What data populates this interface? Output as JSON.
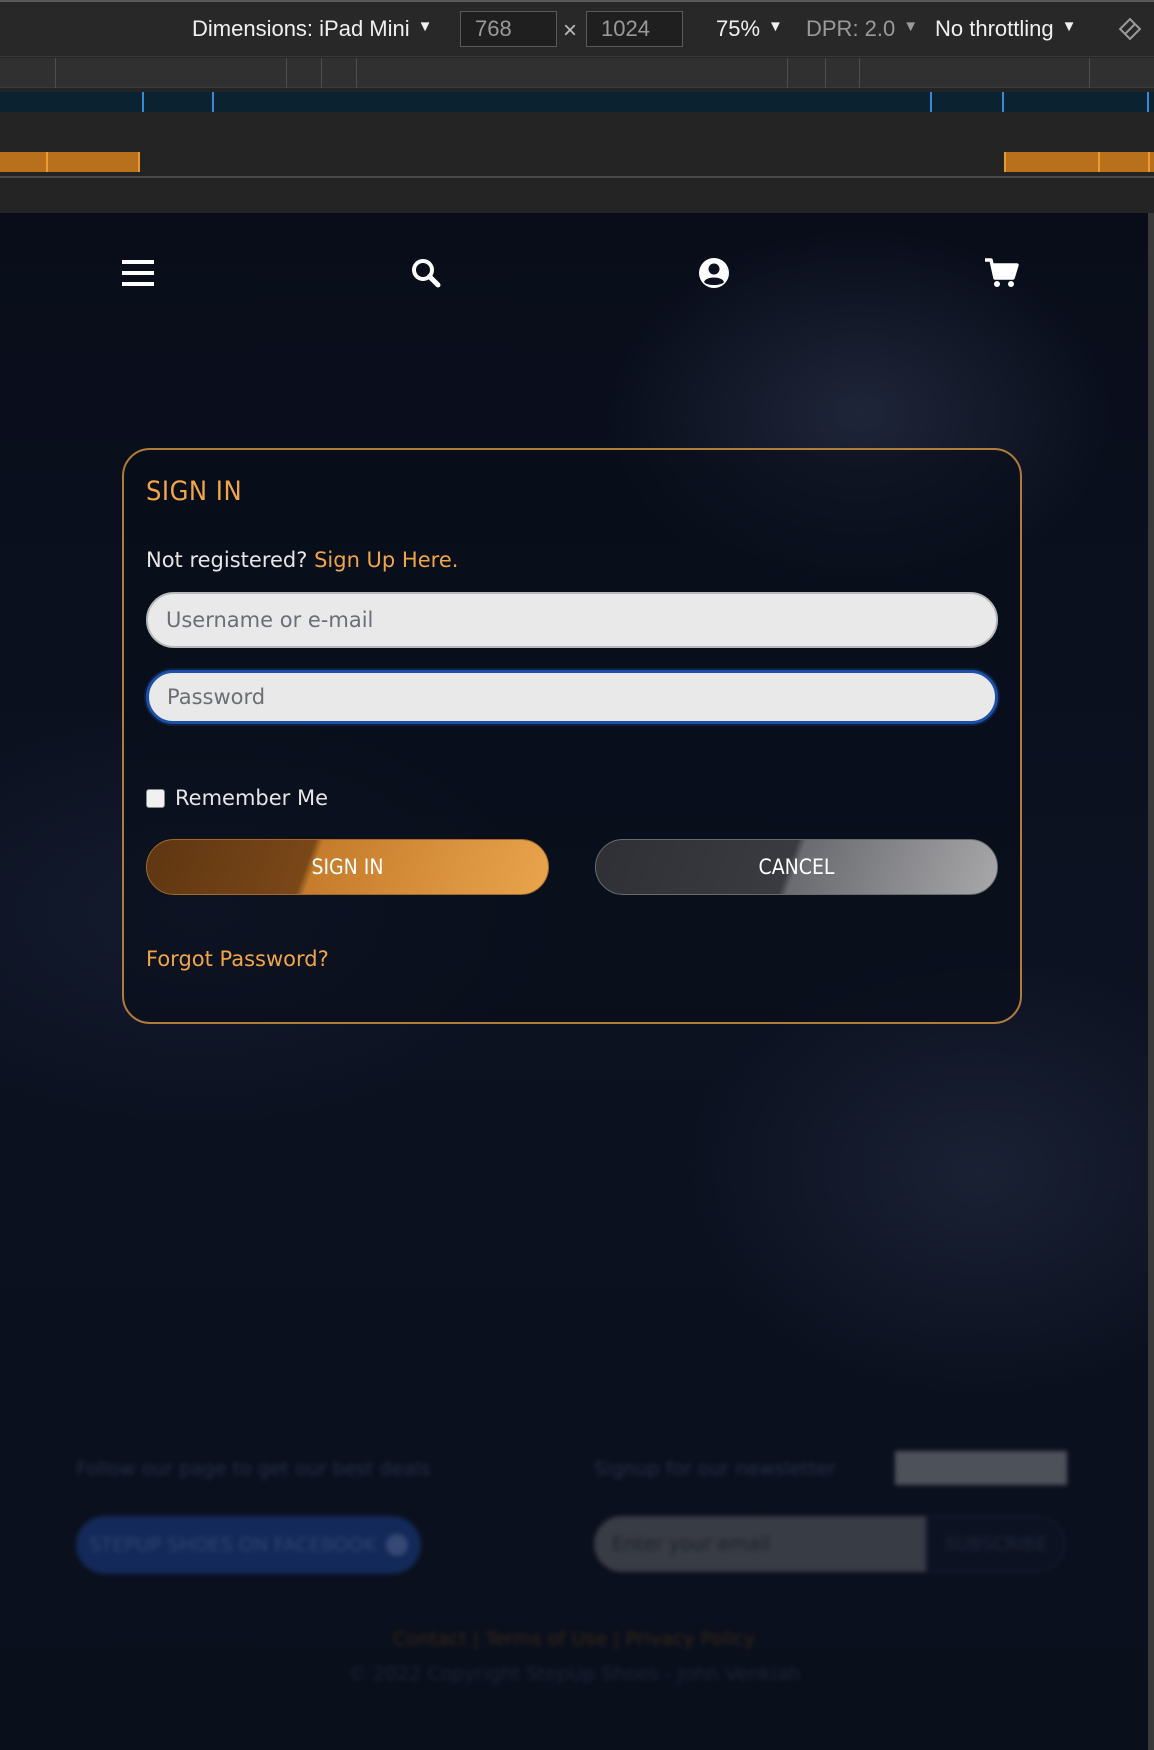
{
  "devtools": {
    "dimensions_label": "Dimensions: iPad Mini",
    "width_value": "768",
    "height_value": "1024",
    "times_symbol": "×",
    "zoom": "75%",
    "dpr": "DPR: 2.0",
    "throttling": "No throttling",
    "caret": "▼",
    "colors": {
      "bar_blue": "#3a87d6",
      "bar_orange": "#b8701b"
    }
  },
  "nav": {
    "icons": [
      "menu-icon",
      "search-icon",
      "user-icon",
      "cart-icon"
    ]
  },
  "signin": {
    "title": "SIGN IN",
    "not_registered": "Not registered?",
    "signup_link": "Sign Up Here",
    "signup_dot": ".",
    "username_placeholder": "Username or e-mail",
    "password_placeholder": "Password",
    "remember_me": "Remember Me",
    "signin_button": "SIGN IN",
    "cancel_button": "CANCEL",
    "forgot_password": "Forgot Password?",
    "accent_color": "#f1a54a"
  },
  "footer": {
    "follow_text": "Follow our page to get our best deals",
    "facebook_button": "STEPUP SHOES ON FACEBOOK",
    "newsletter_text": "Signup for our newsletter",
    "email_placeholder": "Enter your email",
    "subscribe_button": "SUBSCRIBE",
    "links": "Contact | Terms of Use | Privacy Policy",
    "copyright": "© 2022 Copyright StepUp Shoes - John Venkiah"
  }
}
